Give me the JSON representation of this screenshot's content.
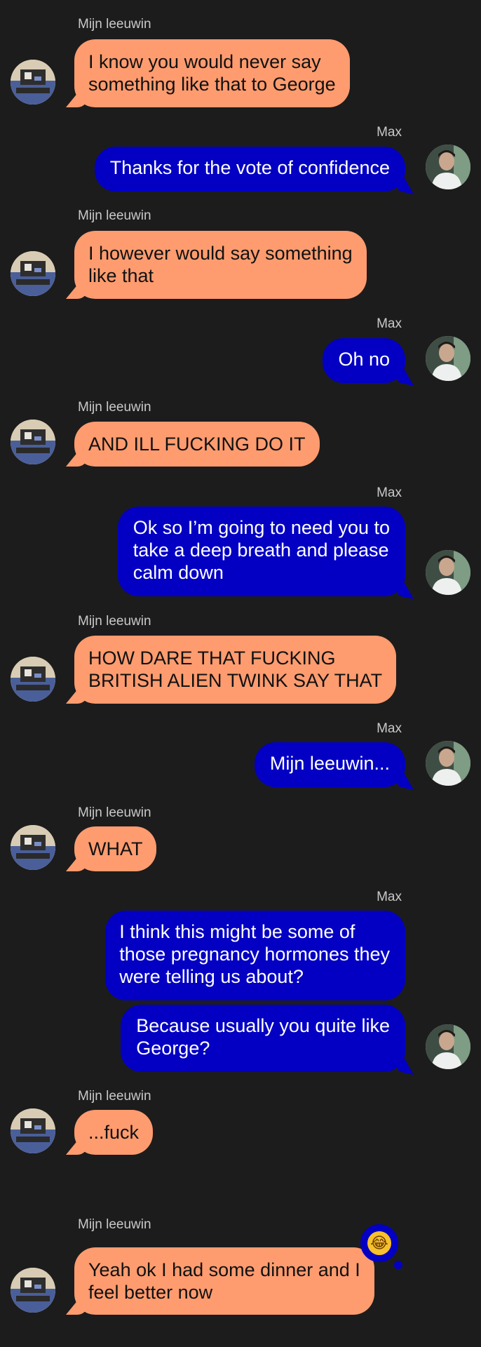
{
  "contacts": {
    "leeuwin": "Mijn leeuwin",
    "max": "Max"
  },
  "colors": {
    "background": "#1c1c1c",
    "incoming_bubble": "#fe9c6f",
    "outgoing_bubble": "#0300c3"
  },
  "messages": [
    {
      "sender": "Mijn leeuwin",
      "lines": [
        "I know you would never say",
        "something like that to George"
      ]
    },
    {
      "sender": "Max",
      "lines": [
        "Thanks for the vote of confidence"
      ]
    },
    {
      "sender": "Mijn leeuwin",
      "lines": [
        "I however would say something",
        "like that"
      ]
    },
    {
      "sender": "Max",
      "lines": [
        "Oh no"
      ]
    },
    {
      "sender": "Mijn leeuwin",
      "lines": [
        "AND ILL FUCKING DO IT"
      ]
    },
    {
      "sender": "Max",
      "lines": [
        "Ok so I’m going to need you to",
        "take a deep breath and please",
        "calm down"
      ]
    },
    {
      "sender": "Mijn leeuwin",
      "lines": [
        "HOW DARE THAT FUCKING",
        "BRITISH ALIEN TWINK SAY THAT"
      ]
    },
    {
      "sender": "Max",
      "lines": [
        "Mijn leeuwin..."
      ]
    },
    {
      "sender": "Mijn leeuwin",
      "lines": [
        "WHAT"
      ]
    },
    {
      "sender": "Max",
      "lines": [
        "I think this might be some of",
        "those pregnancy hormones they",
        "were telling us about?"
      ]
    },
    {
      "sender": "Max",
      "lines": [
        "Because usually you quite like",
        "George?"
      ]
    },
    {
      "sender": "Mijn leeuwin",
      "lines": [
        "...fuck"
      ]
    },
    {
      "sender": "Mijn leeuwin",
      "lines": [
        "Yeah ok I had some dinner and I",
        "feel better now"
      ]
    }
  ],
  "reaction": {
    "icon": "rolling-on-floor-laughing-emoji-icon",
    "glyph": "😂"
  }
}
